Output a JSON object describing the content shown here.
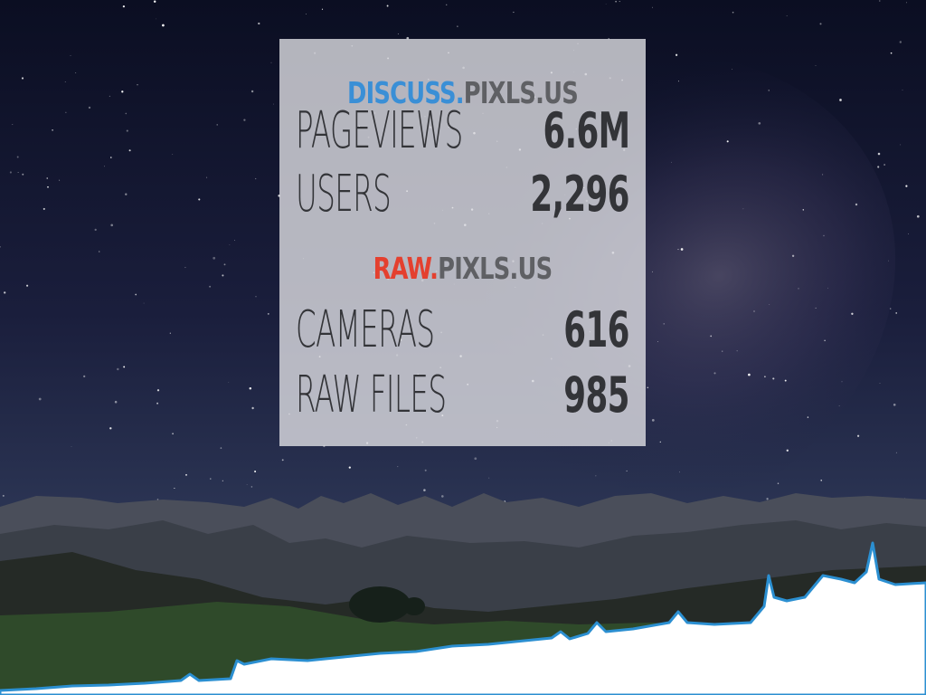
{
  "discuss": {
    "prefix": "DISCUSS.",
    "suffix": "PIXLS.US",
    "stats": [
      {
        "label": "PAGEVIEWS",
        "value": "6.6M"
      },
      {
        "label": "USERS",
        "value": "2,296"
      }
    ]
  },
  "raw": {
    "prefix": "RAW.",
    "suffix": "PIXLS.US",
    "stats": [
      {
        "label": "CAMERAS",
        "value": "616"
      },
      {
        "label": "RAW FILES",
        "value": "985"
      }
    ]
  },
  "colors": {
    "discuss_accent": "#3a8fd6",
    "raw_accent": "#e4402f",
    "chart_line": "#2b8fd1"
  }
}
